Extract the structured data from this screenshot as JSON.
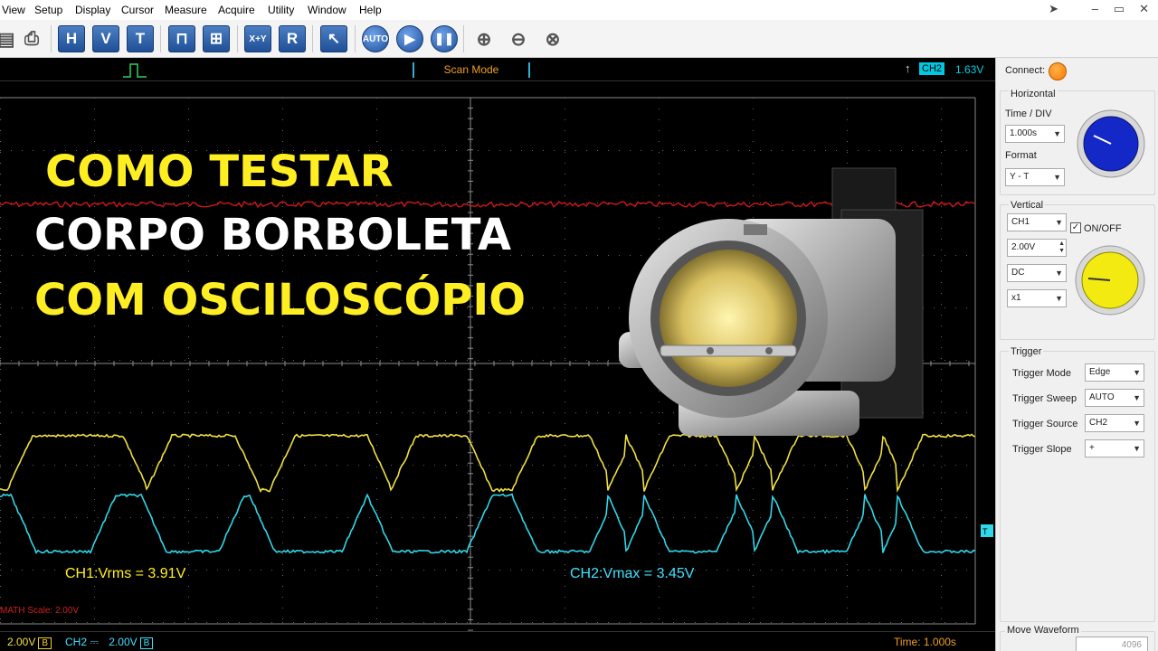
{
  "menu": [
    "View",
    "Setup",
    "Display",
    "Cursor",
    "Measure",
    "Acquire",
    "Utility",
    "Window",
    "Help"
  ],
  "toolbar": {
    "buttons": [
      {
        "name": "h-button",
        "label": "H"
      },
      {
        "name": "v-button",
        "label": "V"
      },
      {
        "name": "t-button",
        "label": "T"
      },
      {
        "name": "x-plus-y-button",
        "label": "X+Y"
      },
      {
        "name": "r-button",
        "label": "R"
      },
      {
        "name": "auto-button",
        "label": "AUTO"
      }
    ]
  },
  "scope": {
    "scan_mode": "Scan Mode",
    "trigger_channel": "CH2",
    "trigger_level": "1.63V",
    "headline": [
      "COMO TESTAR",
      "CORPO BORBOLETA",
      "COM OSCILOSCÓPIO"
    ],
    "ch1_measure": "CH1:Vrms = 3.91V",
    "ch2_measure": "CH2:Vmax = 3.45V",
    "math_scale": "MATH Scale: 2.00V",
    "bottom": {
      "ch1_scale": "2.00V",
      "ch1_badge": "B",
      "ch2_label": "CH2",
      "ch2_scale": "2.00V",
      "ch2_badge": "B",
      "time": "Time:  1.000s"
    }
  },
  "panel": {
    "connect_label": "Connect:",
    "horizontal_title": "Horizontal",
    "time_div_label": "Time / DIV",
    "time_div_value": "1.000s",
    "format_label": "Format",
    "format_value": "Y - T",
    "vertical_title": "Vertical",
    "channel_value": "CH1",
    "onoff_label": "ON/OFF",
    "volts_value": "2.00V",
    "coupling_value": "DC",
    "probe_value": "x1",
    "trigger_title": "Trigger",
    "trigger_rows": [
      {
        "label": "Trigger Mode",
        "value": "Edge"
      },
      {
        "label": "Trigger Sweep",
        "value": "AUTO"
      },
      {
        "label": "Trigger Source",
        "value": "CH2"
      },
      {
        "label": "Trigger Slope",
        "value": "+"
      }
    ],
    "move_waveform_label": "Move Waveform",
    "length_value": "4096"
  },
  "colors": {
    "ch1": "#f0e040",
    "ch2": "#30d8e8",
    "math": "#d01818",
    "grid": "#8a8a8a",
    "headline_yellow": "#ffee22",
    "connect": "#ff8a00",
    "knob_horizontal": "#1428c8",
    "knob_vertical": "#f2ea10"
  }
}
